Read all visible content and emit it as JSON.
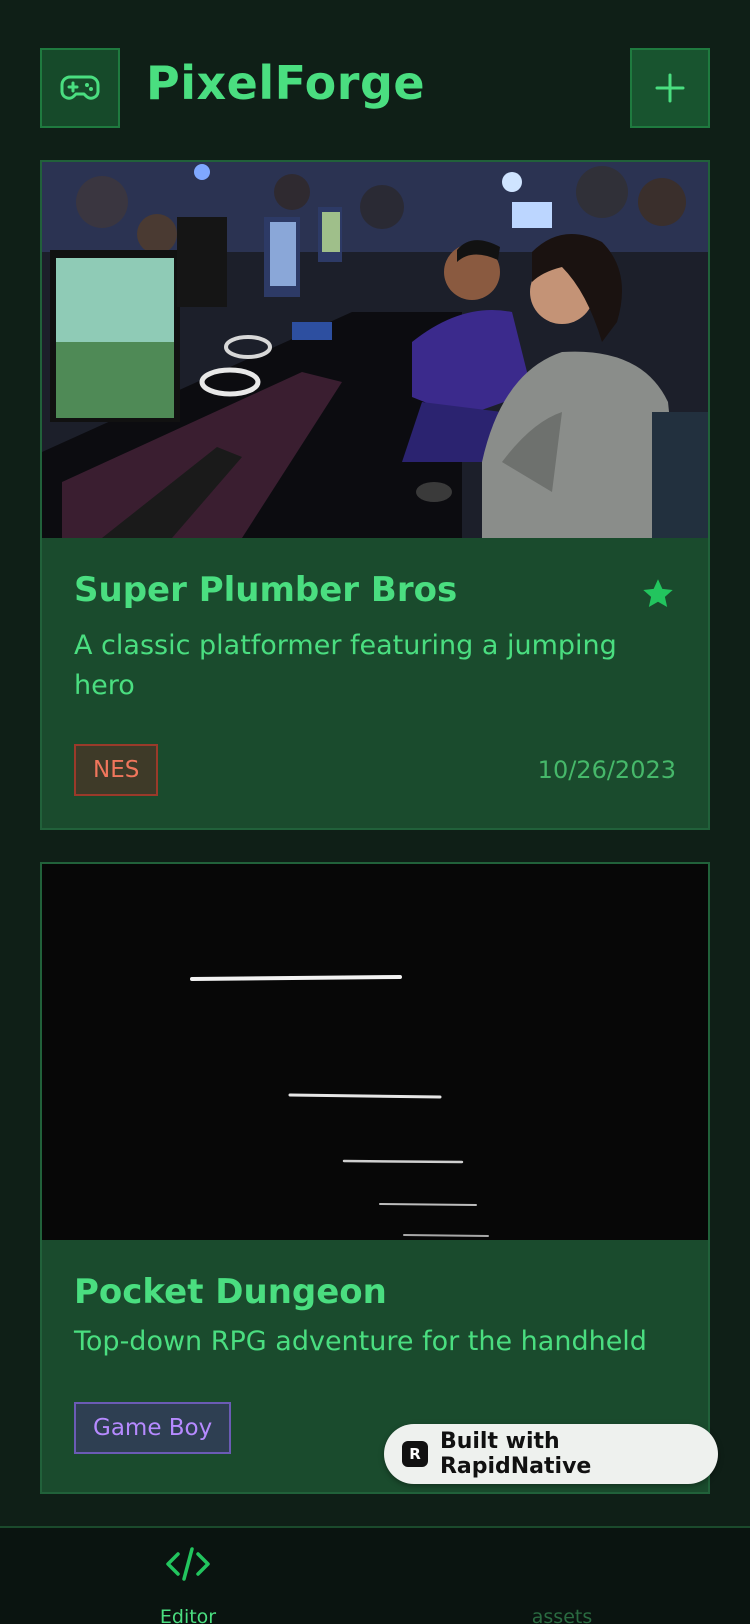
{
  "app": {
    "title": "PixelForge",
    "accent_color": "#4ade80",
    "logo_icon": "gamepad-icon",
    "add_icon": "plus-icon"
  },
  "games": [
    {
      "title": "Super Plumber Bros",
      "description": "A classic platformer featuring a jumping hero",
      "platform": "NES",
      "date": "10/26/2023",
      "favorite": true,
      "favorite_icon": "star-icon",
      "image": "photo of people playing video games at a gaming event"
    },
    {
      "title": "Pocket Dungeon",
      "description": "Top-down RPG adventure for the handheld",
      "platform": "Game Boy",
      "favorite": false,
      "image": "dark image with white horizontal light streaks"
    }
  ],
  "badge": {
    "text": "Built with RapidNative",
    "logo_text": "R"
  },
  "nav": {
    "items": [
      {
        "label": "Editor",
        "icon": "code-icon",
        "active": true
      },
      {
        "label": "assets",
        "icon": "",
        "active": false
      }
    ]
  }
}
